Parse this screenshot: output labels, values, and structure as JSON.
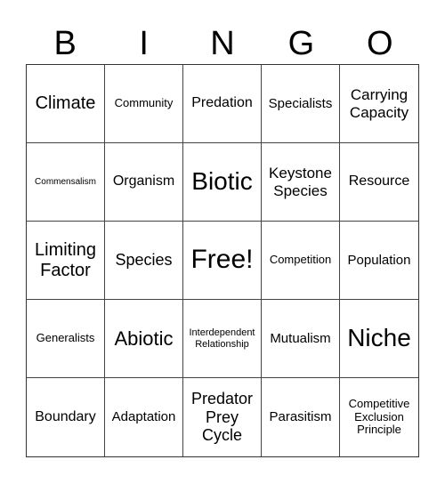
{
  "header": [
    "B",
    "I",
    "N",
    "G",
    "O"
  ],
  "cells": [
    "Climate",
    "Community",
    "Predation",
    "Specialists",
    "Carrying Capacity",
    "Commensalism",
    "Organism",
    "Biotic",
    "Keystone Species",
    "Resource",
    "Limiting Factor",
    "Species",
    "Free!",
    "Competition",
    "Population",
    "Generalists",
    "Abiotic",
    "Interdependent Relationship",
    "Mutualism",
    "Niche",
    "Boundary",
    "Adaptation",
    "Predator Prey Cycle",
    "Parasitism",
    "Competitive Exclusion Principle"
  ]
}
